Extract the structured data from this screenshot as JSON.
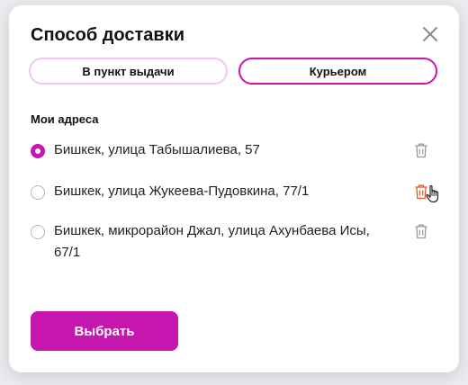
{
  "modal": {
    "title": "Способ доставки",
    "close_icon": "close-icon"
  },
  "tabs": [
    {
      "label": "В пункт выдачи",
      "active": false
    },
    {
      "label": "Курьером",
      "active": true
    }
  ],
  "addresses_label": "Мои адреса",
  "addresses": [
    {
      "text": "Бишкек, улица Табышалиева, 57",
      "selected": true,
      "icon": "trash-icon"
    },
    {
      "text": "Бишкек, улица Жукеева-Пудовкина, 77/1",
      "selected": false,
      "icon": "trash-icon",
      "hovered": true
    },
    {
      "text": "Бишкек, микрорайон Джал, улица Ахунбаева Исы, 67/1",
      "selected": false,
      "icon": "trash-icon"
    }
  ],
  "submit_label": "Выбрать",
  "colors": {
    "accent": "#c516ae",
    "accent_light": "#f3c6ef",
    "trash_default": "#9a9a9a",
    "trash_hover": "#e8542a"
  }
}
